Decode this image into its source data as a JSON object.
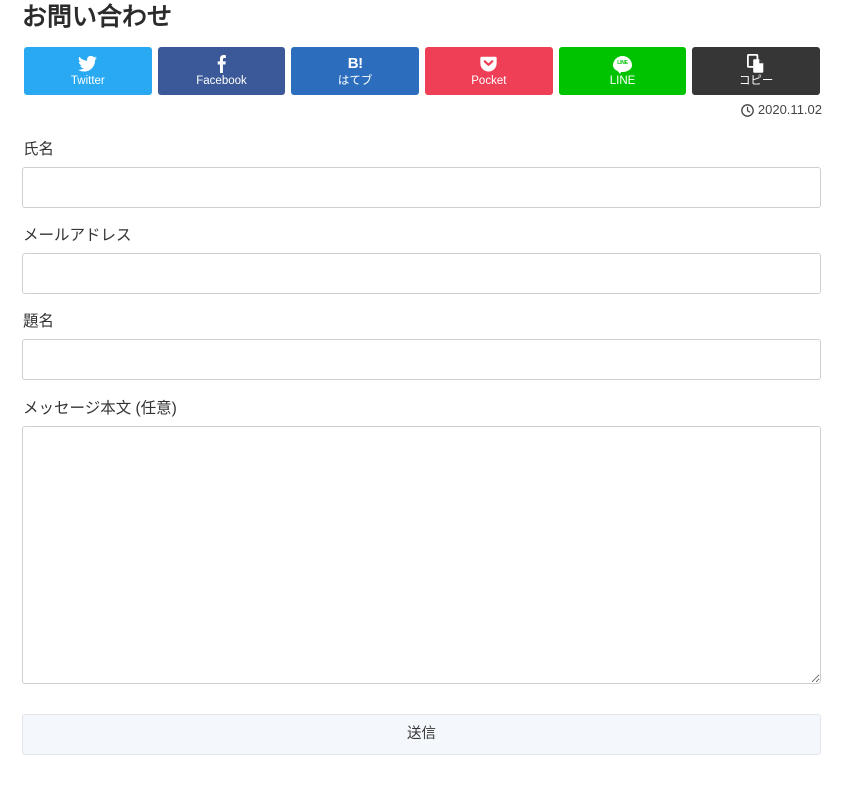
{
  "page": {
    "title": "お問い合わせ"
  },
  "share": {
    "buttons": [
      {
        "name": "twitter",
        "label": "Twitter",
        "icon": "twitter-bird-icon",
        "color": "#28a9f2"
      },
      {
        "name": "facebook",
        "label": "Facebook",
        "icon": "facebook-f-icon",
        "color": "#3b5998"
      },
      {
        "name": "hatena",
        "label": "はてブ",
        "icon": "hatena-b-icon",
        "glyph": "B!",
        "color": "#2c6ebd"
      },
      {
        "name": "pocket",
        "label": "Pocket",
        "icon": "pocket-shield-icon",
        "color": "#ef3f56"
      },
      {
        "name": "line",
        "label": "LINE",
        "icon": "line-bubble-icon",
        "glyph": "LINE",
        "color": "#00c300"
      },
      {
        "name": "copy",
        "label": "コピー",
        "icon": "copy-document-icon",
        "color": "#363636"
      }
    ]
  },
  "meta": {
    "date_icon": "clock-icon",
    "date": "2020.11.02"
  },
  "form": {
    "fields": [
      {
        "name": "name",
        "label": "氏名",
        "value": "",
        "placeholder": ""
      },
      {
        "name": "email",
        "label": "メールアドレス",
        "value": "",
        "placeholder": ""
      },
      {
        "name": "subject",
        "label": "題名",
        "value": "",
        "placeholder": ""
      },
      {
        "name": "message",
        "label": "メッセージ本文 (任意)",
        "value": "",
        "placeholder": ""
      }
    ],
    "submit_label": "送信"
  }
}
